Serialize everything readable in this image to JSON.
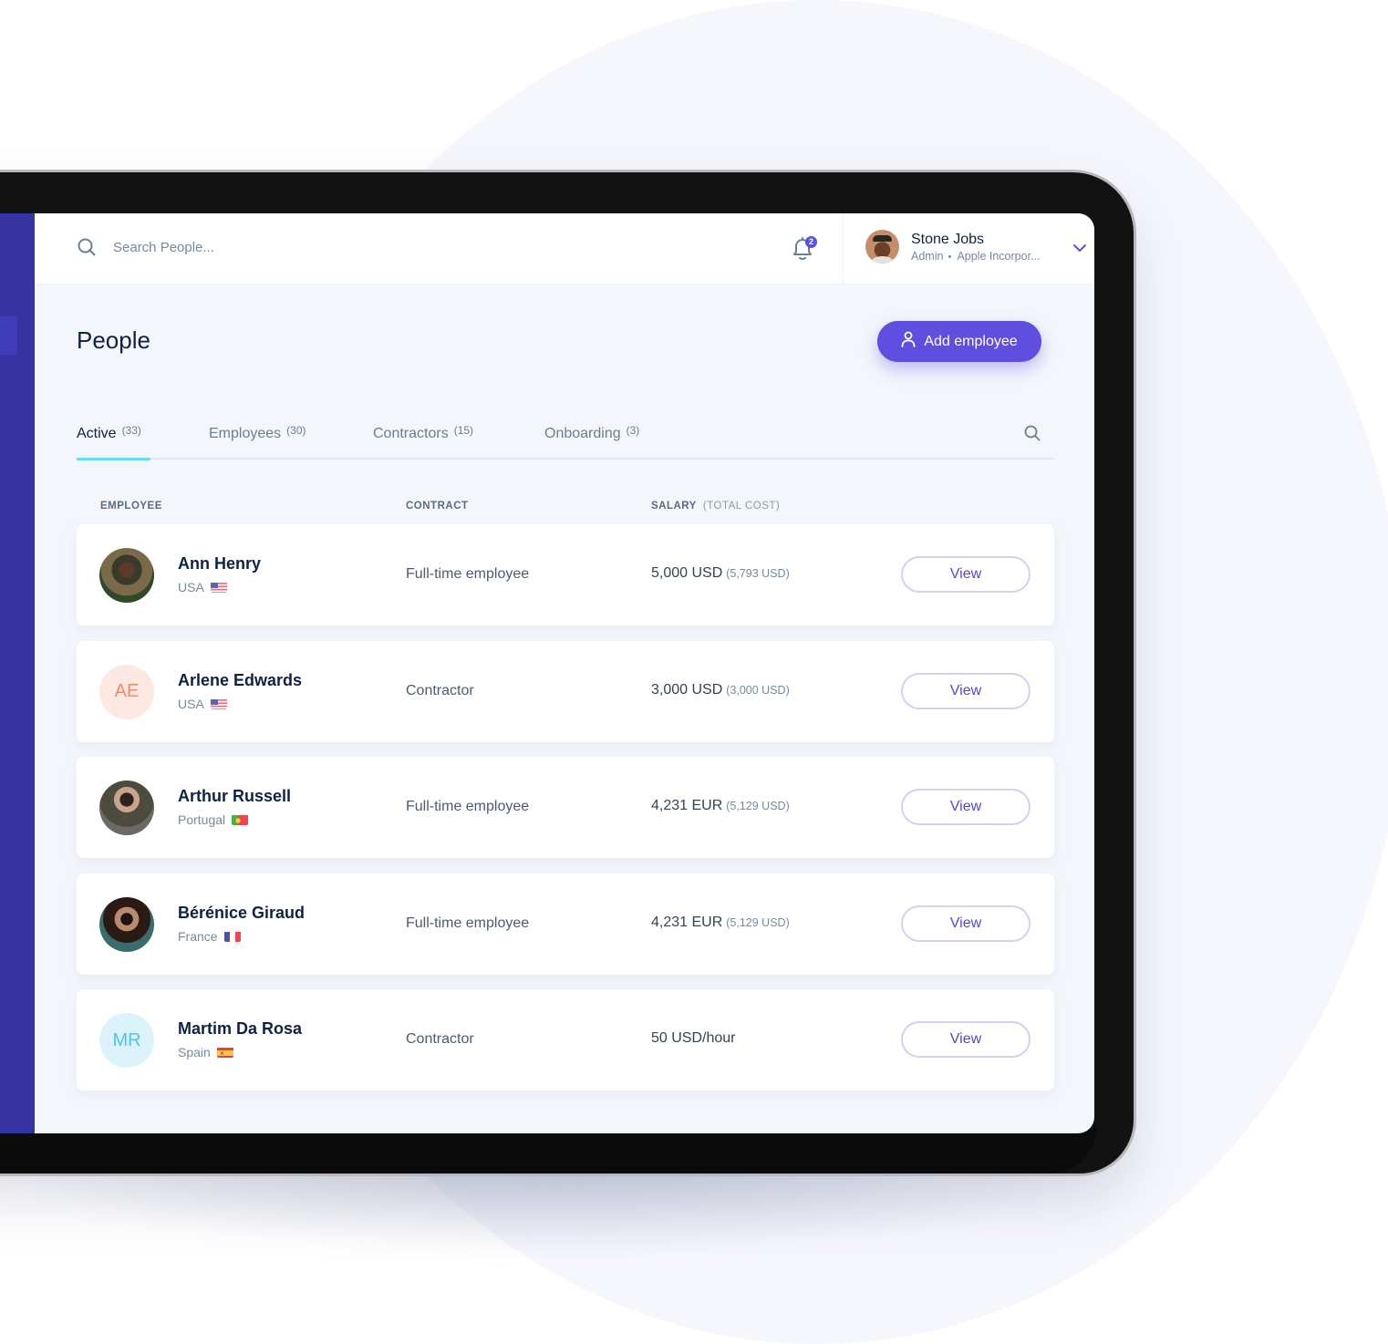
{
  "topbar": {
    "search_placeholder": "Search People...",
    "notifications_count": "2",
    "user": {
      "name": "Stone Jobs",
      "role": "Admin",
      "company": "Apple Incorpor..."
    }
  },
  "page": {
    "title": "People",
    "add_button_label": "Add employee"
  },
  "tabs": [
    {
      "label": "Active",
      "count": "(33)",
      "active": true
    },
    {
      "label": "Employees",
      "count": "(30)",
      "active": false
    },
    {
      "label": "Contractors",
      "count": "(15)",
      "active": false
    },
    {
      "label": "Onboarding",
      "count": "(3)",
      "active": false
    }
  ],
  "columns": {
    "employee": "EMPLOYEE",
    "contract": "CONTRACT",
    "salary": "SALARY",
    "salary_sub": "(TOTAL COST)"
  },
  "rows": [
    {
      "name": "Ann Henry",
      "country": "USA",
      "flag": "us",
      "initials": "",
      "contract": "Full-time employee",
      "salary": "5,000 USD",
      "total_cost": "(5,793 USD)",
      "action": "View"
    },
    {
      "name": "Arlene Edwards",
      "country": "USA",
      "flag": "us",
      "initials": "AE",
      "contract": "Contractor",
      "salary": "3,000 USD",
      "total_cost": "(3,000 USD)",
      "action": "View"
    },
    {
      "name": "Arthur Russell",
      "country": "Portugal",
      "flag": "pt",
      "initials": "",
      "contract": "Full-time employee",
      "salary": "4,231 EUR",
      "total_cost": "(5,129 USD)",
      "action": "View"
    },
    {
      "name": "Bérénice Giraud",
      "country": "France",
      "flag": "fr",
      "initials": "",
      "contract": "Full-time employee",
      "salary": "4,231 EUR",
      "total_cost": "(5,129 USD)",
      "action": "View"
    },
    {
      "name": "Martim Da Rosa",
      "country": "Spain",
      "flag": "es",
      "initials": "MR",
      "contract": "Contractor",
      "salary": "50 USD/hour",
      "total_cost": "",
      "action": "View"
    }
  ],
  "colors": {
    "accent": "#5f4ee0",
    "sidebar": "#3633a3",
    "tab_underline": "#5fe0ea",
    "initials_ae_bg": "#fde9e2",
    "initials_ae_fg": "#f58a66",
    "initials_mr_bg": "#dcf3fc",
    "initials_mr_fg": "#4fc3ee"
  }
}
